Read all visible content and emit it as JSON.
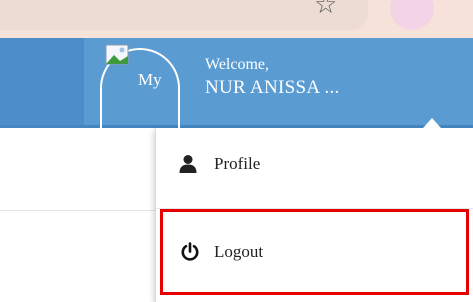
{
  "header": {
    "avatar_alt": "My",
    "welcome": "Welcome,",
    "username": "NUR ANISSA ..."
  },
  "menu": {
    "items": [
      {
        "label": "Profile",
        "icon": "user-icon"
      },
      {
        "label": "Logout",
        "icon": "power-icon"
      }
    ]
  },
  "colors": {
    "header": "#5a9cd2",
    "highlight": "#e60000"
  }
}
